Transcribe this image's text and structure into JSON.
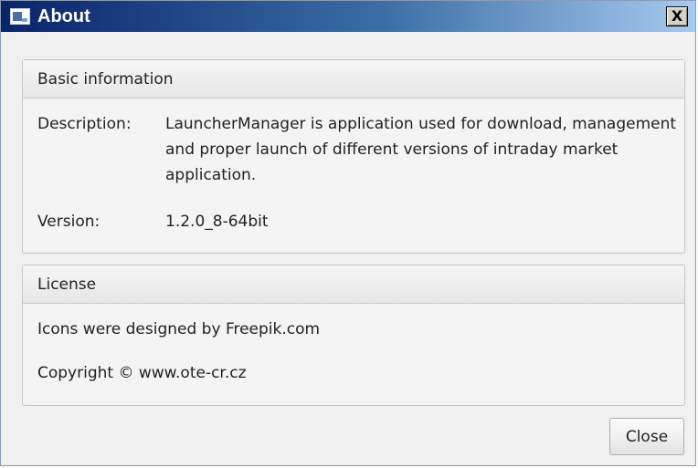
{
  "window": {
    "title": "About",
    "close_glyph": "X"
  },
  "basic_info": {
    "header": "Basic information",
    "description_label": "Description:",
    "description_value": "LauncherManager is application used for download, management and proper launch of different versions of intraday market application.",
    "version_label": "Version:",
    "version_value": "1.2.0_8-64bit"
  },
  "license": {
    "header": "License",
    "lines": [
      "Icons were designed by Freepik.com",
      "Copyright © www.ote-cr.cz"
    ]
  },
  "footer": {
    "close_label": "Close"
  },
  "colors": {
    "titlebar_start": "#0a246a",
    "titlebar_end": "#a6caf0",
    "dialog_bg": "#f0f0f0"
  },
  "icons": {
    "app": "app-window-icon",
    "close": "close-icon"
  }
}
